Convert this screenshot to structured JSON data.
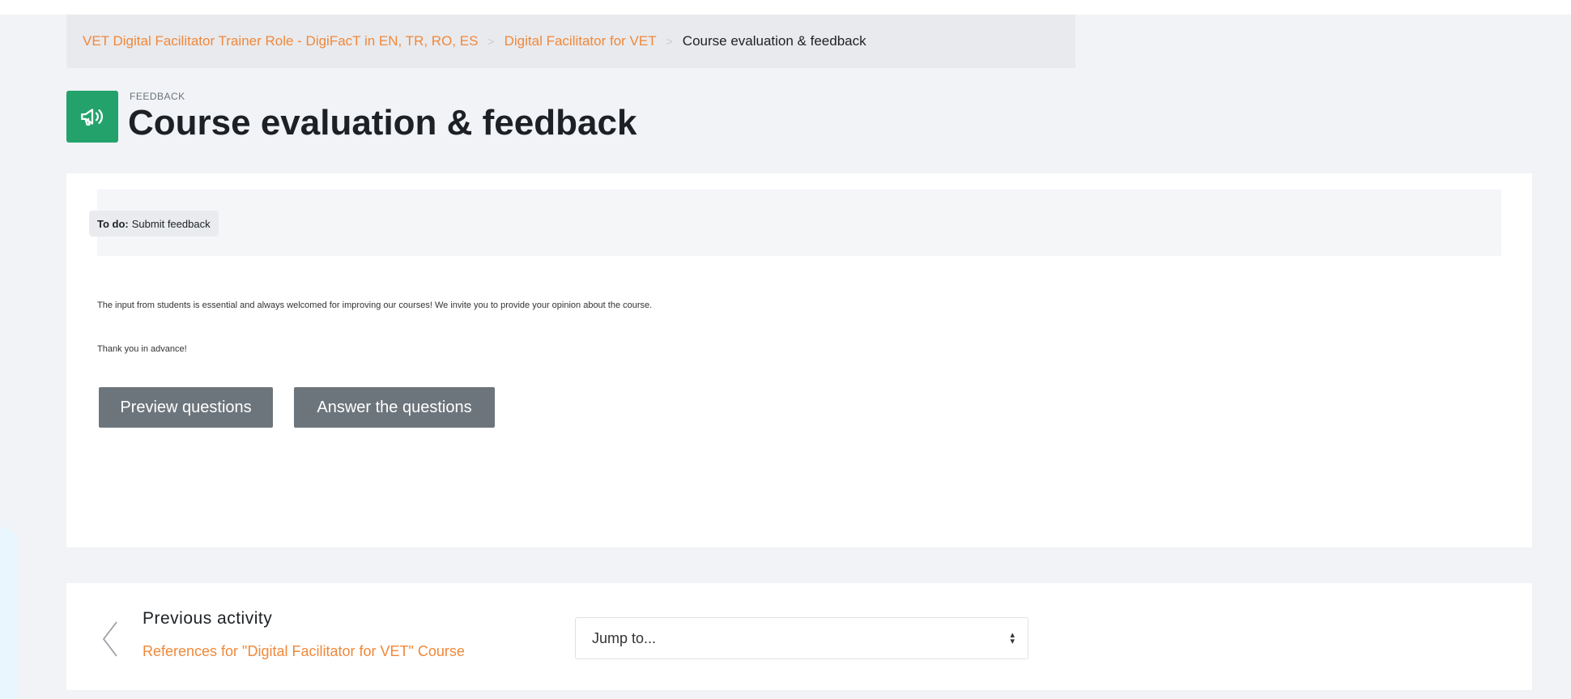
{
  "breadcrumb": {
    "items": [
      {
        "label": "VET Digital Facilitator Trainer Role - DigiFacT in EN, TR, RO, ES"
      },
      {
        "label": "Digital Facilitator for VET"
      }
    ],
    "current": "Course evaluation & feedback",
    "separator": ">"
  },
  "header": {
    "activity_type": "FEEDBACK",
    "title": "Course evaluation & feedback",
    "icon": "megaphone-icon",
    "icon_color": "#23a36b"
  },
  "todo": {
    "label": "To do:",
    "value": "Submit feedback"
  },
  "content": {
    "intro": "The input from students is essential and always welcomed for improving our courses! We invite you to provide your opinion about the course.",
    "thanks": "Thank you in advance!"
  },
  "actions": {
    "preview_label": "Preview questions",
    "answer_label": "Answer the questions"
  },
  "navigation": {
    "previous_label": "Previous activity",
    "previous_link": "References  for \"Digital Facilitator for VET\" Course",
    "jump_placeholder": "Jump to...",
    "chevron_icon": "chevron-left-icon"
  },
  "colors": {
    "link": "#f0883a",
    "button": "#6d757c",
    "page_bg": "#f2f3f6"
  }
}
